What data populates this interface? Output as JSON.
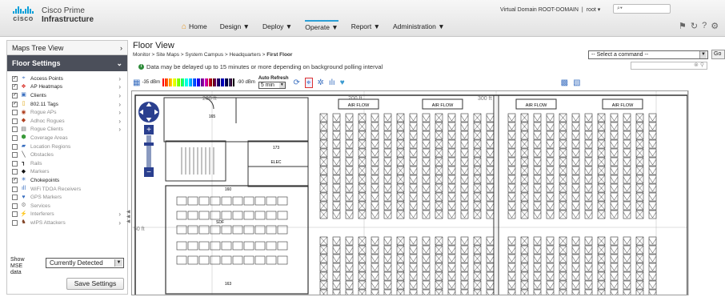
{
  "header": {
    "brand": "cisco",
    "product_line1": "Cisco Prime",
    "product_line2": "Infrastructure",
    "virtual_domain": "Virtual Domain ROOT-DOMAIN",
    "separator": "|",
    "user": "root ▾",
    "search_placeholder": "⌕▾",
    "nav": [
      {
        "label": "Home"
      },
      {
        "label": "Design ▼"
      },
      {
        "label": "Deploy ▼"
      },
      {
        "label": "Operate ▼"
      },
      {
        "label": "Report ▼"
      },
      {
        "label": "Administration ▼"
      }
    ]
  },
  "sidebar": {
    "tree_view": "Maps Tree View",
    "floor_settings": "Floor Settings",
    "layers": [
      {
        "label": "Access Points",
        "checked": true,
        "icon": "access-point-icon",
        "color": "#3a6fc0"
      },
      {
        "label": "AP Heatmaps",
        "checked": true,
        "icon": "heatmap-icon",
        "color": "#d9332b"
      },
      {
        "label": "Clients",
        "checked": true,
        "icon": "client-icon",
        "color": "#3a6fc0"
      },
      {
        "label": "802.11 Tags",
        "checked": true,
        "icon": "tag-icon",
        "color": "#e0a000"
      },
      {
        "label": "Rogue APs",
        "checked": false,
        "icon": "rogue-ap-icon",
        "color": "#b04020"
      },
      {
        "label": "Adhoc Rogues",
        "checked": false,
        "icon": "adhoc-rogue-icon",
        "color": "#b04020"
      },
      {
        "label": "Rogue Clients",
        "checked": false,
        "icon": "rogue-client-icon",
        "color": "#666"
      },
      {
        "label": "Coverage Areas",
        "checked": false,
        "icon": "coverage-icon",
        "color": "#3a9a3a"
      },
      {
        "label": "Location Regions",
        "checked": false,
        "icon": "location-region-icon",
        "color": "#3a6fc0"
      },
      {
        "label": "Obstacles",
        "checked": false,
        "icon": "obstacle-icon",
        "color": "#333"
      },
      {
        "label": "Rails",
        "checked": false,
        "icon": "rail-icon",
        "color": "#333"
      },
      {
        "label": "Markers",
        "checked": false,
        "icon": "marker-icon",
        "color": "#111"
      },
      {
        "label": "Chokepoints",
        "checked": true,
        "icon": "chokepoint-icon",
        "color": "#3a6fc0"
      },
      {
        "label": "WiFi TDOA Receivers",
        "checked": false,
        "icon": "tdoa-icon",
        "color": "#3a6fc0"
      },
      {
        "label": "GPS Markers",
        "checked": false,
        "icon": "gps-icon",
        "color": "#3a6fc0"
      },
      {
        "label": "Services",
        "checked": false,
        "icon": "services-icon",
        "color": "#888"
      },
      {
        "label": "Interferers",
        "checked": false,
        "icon": "interferer-icon",
        "color": "#e0a000"
      },
      {
        "label": "wIPS Attackers",
        "checked": false,
        "icon": "wips-icon",
        "color": "#7a3a1a"
      }
    ],
    "mse_label": "Show MSE data",
    "mse_value": "Currently Detected",
    "save_label": "Save Settings"
  },
  "floor": {
    "title": "Floor View",
    "breadcrumb_prefix": "Monitor > Site Maps > System Campus > Headquarters > ",
    "breadcrumb_current": "First Floor",
    "note": "Data may be delayed up to 15 minutes or more depending on background polling interval",
    "command_placeholder": "-- Select a command --",
    "go_label": "Go",
    "rssi_min": "-35 dBm",
    "rssi_max": "-90 dBm",
    "auto_refresh_label": "Auto Refresh",
    "refresh_value": "5 min"
  },
  "map": {
    "scale_labels": [
      "200 ft",
      "200 ft",
      "300 ft",
      "50 ft"
    ],
    "air_flow": "AIR FLOW",
    "rooms": [
      "165",
      "173",
      "ELEC",
      "160",
      "SDF",
      "163"
    ]
  }
}
